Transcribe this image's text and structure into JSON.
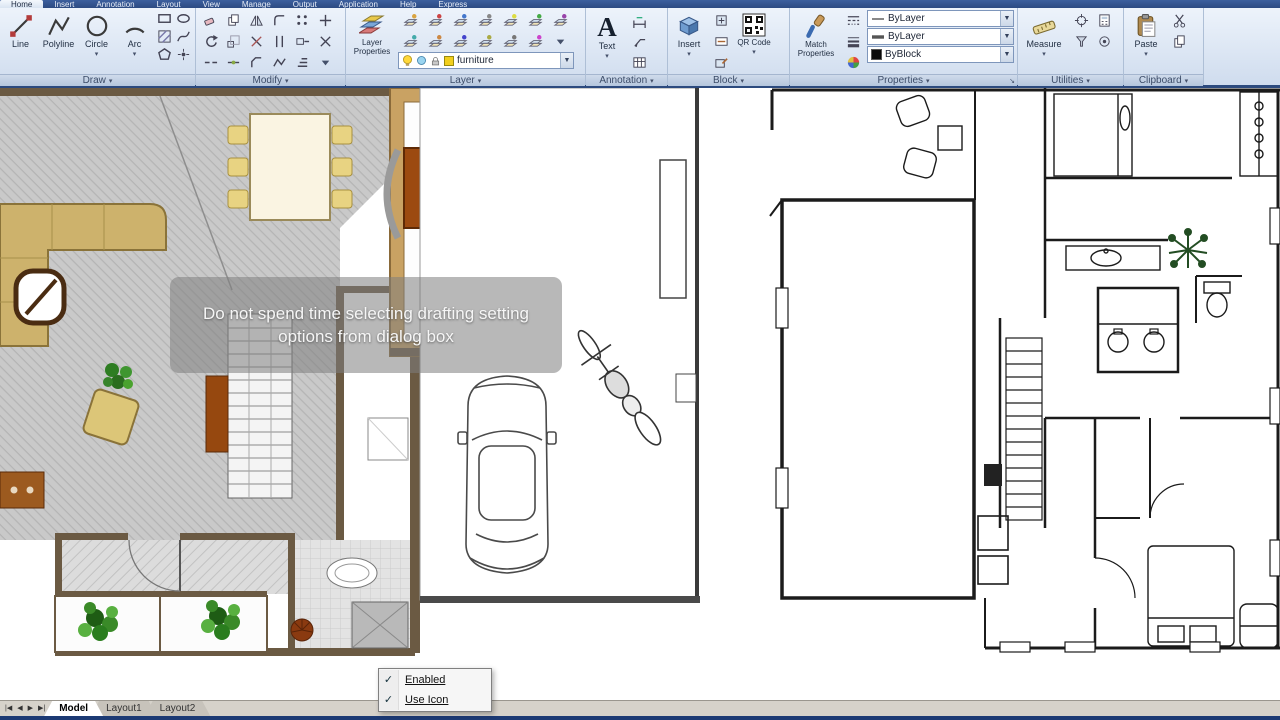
{
  "ribbon": {
    "tabs": [
      "Home",
      "Insert",
      "Annotation",
      "Layout",
      "View",
      "Manage",
      "Output",
      "Application",
      "Help",
      "Express"
    ],
    "panel_labels": {
      "draw": "Draw",
      "modify": "Modify",
      "layer": "Layer",
      "annotation": "Annotation",
      "block": "Block",
      "properties": "Properties",
      "utilities": "Utilities",
      "clipboard": "Clipboard"
    },
    "draw": {
      "line": "Line",
      "polyline": "Polyline",
      "circle": "Circle",
      "arc": "Arc"
    },
    "layer": {
      "layer_properties": "Layer Properties",
      "current_layer": "furniture"
    },
    "annotation": {
      "text": "Text"
    },
    "block": {
      "insert": "Insert",
      "qr_code": "QR Code"
    },
    "properties": {
      "match_properties": "Match Properties",
      "object_color": "ByLayer",
      "lineweight": "ByLayer",
      "linetype": "ByBlock"
    },
    "utilities": {
      "measure": "Measure"
    },
    "clipboard": {
      "paste": "Paste"
    }
  },
  "canvas": {
    "tooltip_line1": "Do not spend time selecting drafting setting",
    "tooltip_line2": "options from dialog box"
  },
  "context_menu": {
    "items": [
      {
        "label": "Enabled",
        "checked": true
      },
      {
        "label": "Use Icon",
        "checked": true
      }
    ]
  },
  "layout_bar": {
    "tabs": [
      "Model",
      "Layout1",
      "Layout2"
    ],
    "active_tab": "Model"
  },
  "colors": {
    "ribbon_accent": "#2c4a7e",
    "status_bar": "#1c3a74",
    "wall_brown": "#6b5a43",
    "kitchen_tan": "#c9a263",
    "sofa_tan": "#cdb26c",
    "island_rust": "#9c4a10",
    "layer_chip_yellow": "#f2cf1d"
  }
}
